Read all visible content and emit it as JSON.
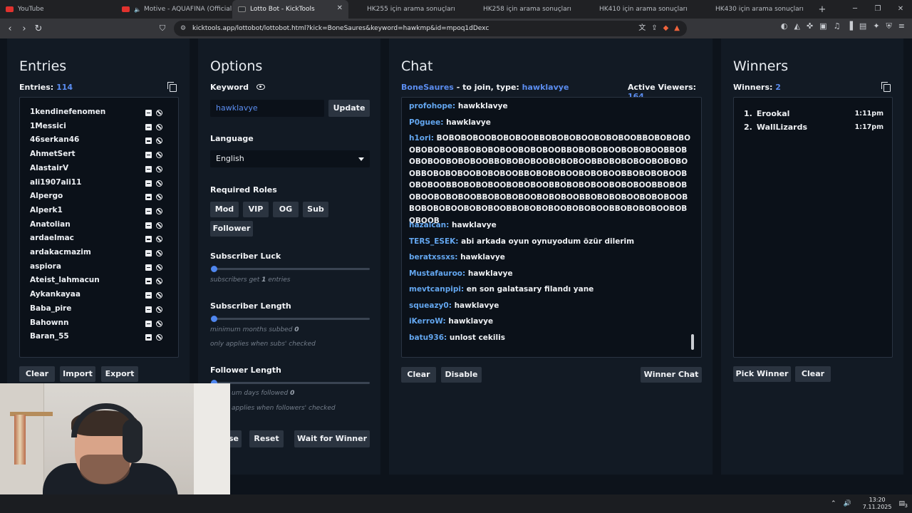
{
  "browser": {
    "tabs": [
      {
        "label": "YouTube",
        "icon": "youtube-icon"
      },
      {
        "label": "Motive - AQUAFINA (Official Mu",
        "icon": "youtube-icon"
      },
      {
        "label": "Lotto Bot - KickTools",
        "icon": "kick-icon"
      },
      {
        "label": "HK255 için arama sonuçları",
        "icon": ""
      },
      {
        "label": "HK258 için arama sonuçları",
        "icon": ""
      },
      {
        "label": "HK410 için arama sonuçları",
        "icon": ""
      },
      {
        "label": "HK430 için arama sonuçları",
        "icon": ""
      }
    ],
    "url": "kicktools.app/lottobot/lottobot.html?kick=BoneSaures&keyword=hawkmp&id=mpoq1dDexc"
  },
  "entries": {
    "title": "Entries",
    "count_label": "Entries:",
    "count": "114",
    "items": [
      "1kendinefenomen",
      "1Messici",
      "46serkan46",
      "AhmetSert",
      "AlastairV",
      "ali1907ali11",
      "Alpergo",
      "Alperk1",
      "Anatolian",
      "ardaelmac",
      "ardakacmazim",
      "aspiora",
      "Ateist_lahmacun",
      "Aykankayaa",
      "Baba_pire",
      "Bahownn",
      "Baran_55"
    ],
    "buttons": {
      "clear": "Clear",
      "import": "Import",
      "export": "Export"
    }
  },
  "options": {
    "title": "Options",
    "keyword_label": "Keyword",
    "keyword_value": "hawklavye",
    "update": "Update",
    "language_label": "Language",
    "language_value": "English",
    "roles_label": "Required Roles",
    "roles": [
      "Mod",
      "VIP",
      "OG",
      "Sub",
      "Follower"
    ],
    "sub_luck_label": "Subscriber Luck",
    "sub_luck_hint_pre": "subscribers get",
    "sub_luck_value": "1",
    "sub_luck_hint_post": "entries",
    "sub_length_label": "Subscriber Length",
    "sub_length_hint_pre": "minimum months subbed",
    "sub_length_value": "0",
    "sub_length_note": "only applies when subs' checked",
    "follower_length_label": "Follower Length",
    "follower_hint_pre": "um days followed",
    "follower_value": "0",
    "follower_note": "applies when followers' checked",
    "btn_pause": "se",
    "btn_reset": "Reset",
    "btn_wait": "Wait for Winner"
  },
  "chat": {
    "title": "Chat",
    "channel": "BoneSaures",
    "join_text": "- to join, type:",
    "keyword": "hawklavye",
    "viewers_label": "Active Viewers:",
    "viewers": "164",
    "messages": [
      {
        "user": "profohope:",
        "text": "hawkklavye"
      },
      {
        "user": "P0guee:",
        "text": "hawklavye"
      },
      {
        "user": "h1ori:",
        "text": "BOBOBOBOOBOBOBOOBBOBOBOBOOBOBOBOOBBOBOBOBOOBOBOBOOBBOBOBOBOOBOBOBOOBBOBOBOBOOBOBOBOOBBOBOBOBOOBOBOBOOBBOBOBOBOOBOBOBOOBBOBOBOBOOBOBOBOOBBOBOBOBOOBOBOBOOBBOBOBOBOOBOBOBOOBBOBOBOBOOBOBOBOOBBOBOBOBOOBOBOBOOBBOBOBOBOOBOBOBOOBBOBOBOBOOBOBOBOOBBOBOBOBOOBOBOBOOBBOBOBOBOOBOBOBOOBBOBOBOBOOBOBOBOOBBOBOBOBOOBOBOBOOBBOBOBOBOOBOBOBOOB"
      },
      {
        "user": "hazalcan:",
        "text": "hawklavye"
      },
      {
        "user": "TERS_ESEK:",
        "text": "abi arkada oyun oynuyodum özür dilerim"
      },
      {
        "user": "beratxssxs:",
        "text": "hawklavye"
      },
      {
        "user": "Mustafauroo:",
        "text": "hawklavye"
      },
      {
        "user": "mevtcanpipi:",
        "text": "en son galatasary filandı yane"
      },
      {
        "user": "squeazy0:",
        "text": "hawklavye"
      },
      {
        "user": "iKerroW:",
        "text": "hawklavye"
      },
      {
        "user": "batu936:",
        "text": "unlost cekilis"
      }
    ],
    "btn_clear": "Clear",
    "btn_disable": "Disable",
    "btn_winner_chat": "Winner Chat"
  },
  "winners": {
    "title": "Winners",
    "count_label": "Winners:",
    "count": "2",
    "items": [
      {
        "rank": "1.",
        "name": "Erookal",
        "time": "1:11pm"
      },
      {
        "rank": "2.",
        "name": "WallLizards",
        "time": "1:17pm"
      }
    ],
    "btn_pick": "Pick Winner",
    "btn_clear": "Clear"
  },
  "taskbar": {
    "time": "13:20",
    "date": "7.11.2025",
    "badge": "3"
  },
  "colors": {
    "accent": "#5b8df0",
    "chat_user": "#63a6ef",
    "panel": "#121a24"
  }
}
